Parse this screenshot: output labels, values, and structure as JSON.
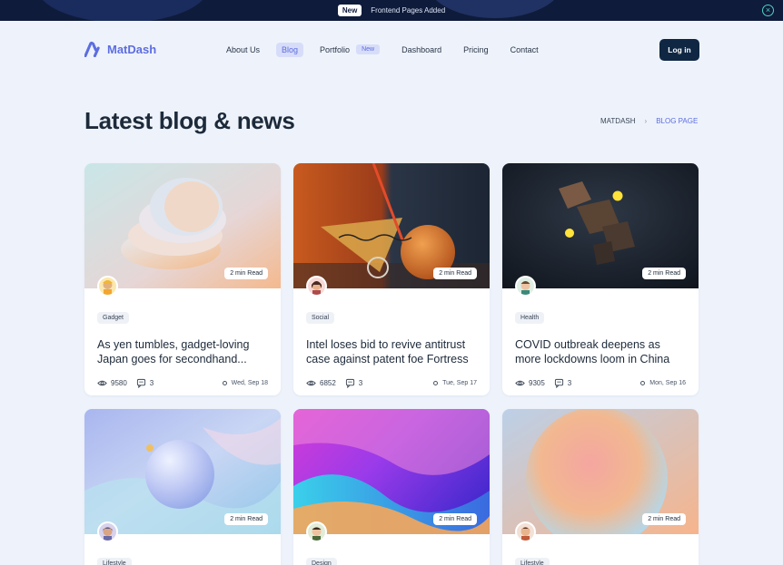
{
  "announcement": {
    "badge": "New",
    "message": "Frontend Pages Added"
  },
  "brand": {
    "name": "MatDash",
    "accent": "#5d6de0"
  },
  "nav": {
    "items": [
      {
        "label": "About Us"
      },
      {
        "label": "Blog",
        "active": true
      },
      {
        "label": "Portfolio",
        "tag": "New"
      },
      {
        "label": "Dashboard"
      },
      {
        "label": "Pricing"
      },
      {
        "label": "Contact"
      }
    ],
    "login_label": "Log in"
  },
  "page": {
    "title": "Latest blog & news",
    "breadcrumb": [
      "MATDASH",
      "BLOG PAGE"
    ]
  },
  "posts": [
    {
      "read": "2 min Read",
      "category": "Gadget",
      "title": "As yen tumbles, gadget-loving Japan goes for secondhand...",
      "views": "9580",
      "comments": "3",
      "date": "Wed, Sep 18"
    },
    {
      "read": "2 min Read",
      "category": "Social",
      "title": "Intel loses bid to revive antitrust case against patent foe Fortress",
      "views": "6852",
      "comments": "3",
      "date": "Tue, Sep 17"
    },
    {
      "read": "2 min Read",
      "category": "Health",
      "title": "COVID outbreak deepens as more lockdowns loom in China",
      "views": "9305",
      "comments": "3",
      "date": "Mon, Sep 16"
    },
    {
      "read": "2 min Read",
      "category": "Lifestyle",
      "title": "",
      "views": "",
      "comments": "",
      "date": ""
    },
    {
      "read": "2 min Read",
      "category": "Design",
      "title": "",
      "views": "",
      "comments": "",
      "date": ""
    },
    {
      "read": "2 min Read",
      "category": "Lifestyle",
      "title": "",
      "views": "",
      "comments": "",
      "date": ""
    }
  ]
}
